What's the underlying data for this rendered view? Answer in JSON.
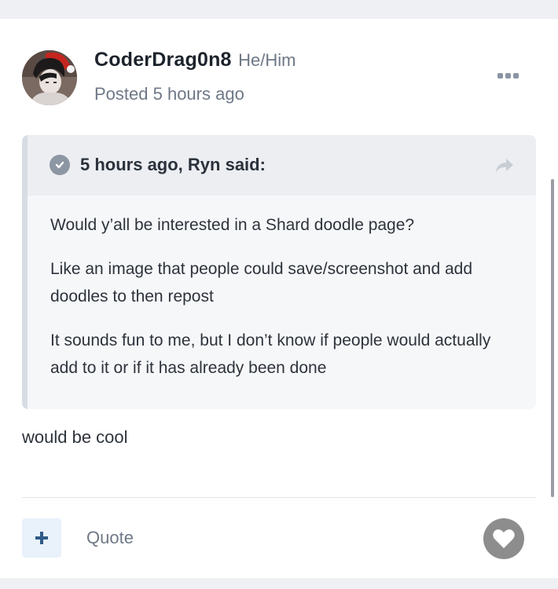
{
  "post": {
    "author_name": "CoderDrag0n8",
    "author_pronouns": "He/Him",
    "posted_time": "Posted 5 hours ago",
    "quote": {
      "citation": "5 hours ago, Ryn said:",
      "paragraphs": [
        "Would y’all be interested in a Shard doodle page?",
        "Like an image that people could save/screenshot and add doodles to then repost",
        "It sounds fun to me, but I don’t know if people would actually add to it or if it has already been done"
      ]
    },
    "body": "would be cool"
  },
  "actions": {
    "add_icon": "plus-icon",
    "quote_label": "Quote",
    "like_icon": "heart-icon",
    "more_icon": "ellipsis-icon",
    "share_icon": "share-arrow-icon"
  },
  "colors": {
    "card_background": "#ffffff",
    "page_background": "#eef0f3",
    "quote_background": "#f6f7f9",
    "accent": "#2d5a86",
    "like_button": "#8d8d8d"
  }
}
